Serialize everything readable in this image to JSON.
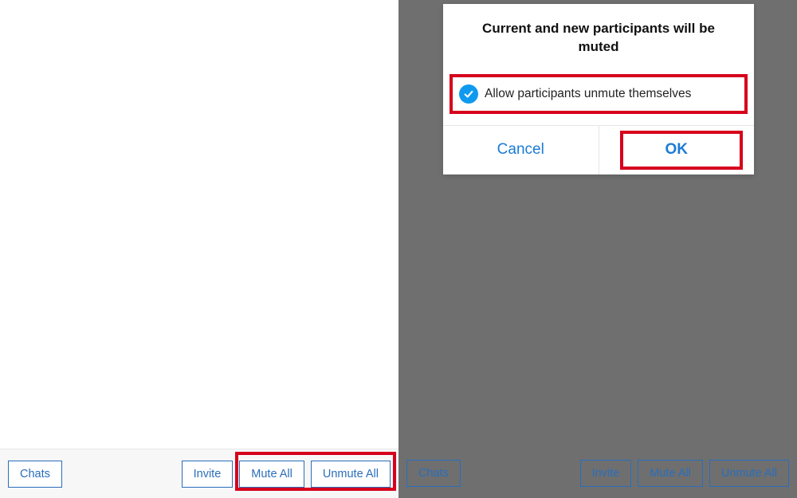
{
  "toolbar": {
    "chats": "Chats",
    "invite": "Invite",
    "mute_all": "Mute All",
    "unmute_all": "Unmute All"
  },
  "dialog": {
    "title": "Current and new participants will be muted",
    "option_label": "Allow participants unmute themselves",
    "cancel": "Cancel",
    "ok": "OK"
  }
}
